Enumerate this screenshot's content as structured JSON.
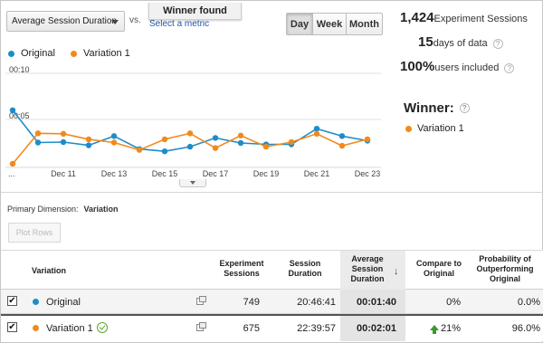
{
  "controls": {
    "metric_label": "Average Session Duration",
    "vs_label": "vs.",
    "select_metric_link": "Select a metric",
    "winner_banner": "Winner found",
    "range_buttons": [
      "Day",
      "Week",
      "Month"
    ],
    "selected_range": "Day"
  },
  "legend": {
    "original": "Original",
    "variation": "Variation 1"
  },
  "colors": {
    "original": "#1e8cc8",
    "variation": "#f08a1e"
  },
  "stats": {
    "sessions_value": "1,424",
    "sessions_label": "Experiment Sessions",
    "days_value": "15",
    "days_label": "days of data",
    "users_value": "100%",
    "users_label": "users included"
  },
  "winner": {
    "title": "Winner:",
    "name": "Variation 1"
  },
  "chart_data": {
    "type": "line",
    "y_axis": {
      "min_label": "00:05",
      "max_label": "00:10",
      "ymin": 0,
      "ymax": 10
    },
    "x_tick_labels": [
      "...",
      "Dec 11",
      "Dec 13",
      "Dec 15",
      "Dec 17",
      "Dec 19",
      "Dec 21",
      "Dec 23"
    ],
    "x_count": 15,
    "series": [
      {
        "name": "Original",
        "values": [
          6.0,
          2.5,
          2.55,
          2.2,
          3.2,
          1.8,
          1.55,
          2.05,
          3.0,
          2.45,
          2.3,
          2.3,
          4.0,
          3.2,
          2.7
        ]
      },
      {
        "name": "Variation 1",
        "values": [
          0.2,
          3.5,
          3.45,
          2.85,
          2.5,
          1.7,
          2.85,
          3.5,
          1.9,
          3.25,
          2.05,
          2.55,
          3.45,
          2.15,
          2.85
        ]
      }
    ]
  },
  "dimension": {
    "label": "Primary Dimension:",
    "value": "Variation"
  },
  "plot_rows_label": "Plot Rows",
  "table": {
    "headers": {
      "variation": "Variation",
      "sessions": "Experiment Sessions",
      "duration": "Session Duration",
      "avg": "Average Session Duration",
      "compare": "Compare to Original",
      "prob": "Probability of Outperforming Original"
    },
    "rows": [
      {
        "name": "Original",
        "sessions": "749",
        "duration": "20:46:41",
        "avg": "00:01:40",
        "compare": "0%",
        "prob": "0.0%"
      },
      {
        "name": "Variation 1",
        "sessions": "675",
        "duration": "22:39:57",
        "avg": "00:02:01",
        "compare": "21%",
        "prob": "96.0%"
      }
    ]
  }
}
